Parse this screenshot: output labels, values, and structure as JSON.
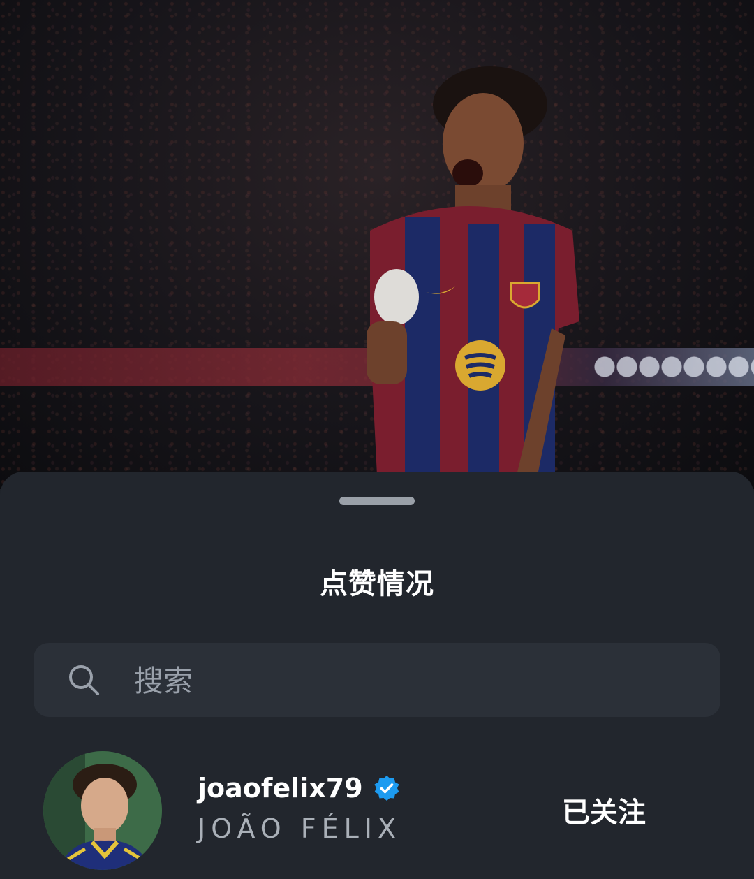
{
  "sheet": {
    "title": "点赞情况"
  },
  "search": {
    "placeholder": "搜索",
    "icon": "search-icon"
  },
  "likes": [
    {
      "username": "joaofelix79",
      "full_name": "JOÃO FÉLIX",
      "verified": true,
      "follow_state": "已关注"
    }
  ],
  "colors": {
    "sheet_bg": "#22262d",
    "search_bg": "#2b3038",
    "verified": "#1d9bf0",
    "secondary_text": "#aab0b8"
  }
}
